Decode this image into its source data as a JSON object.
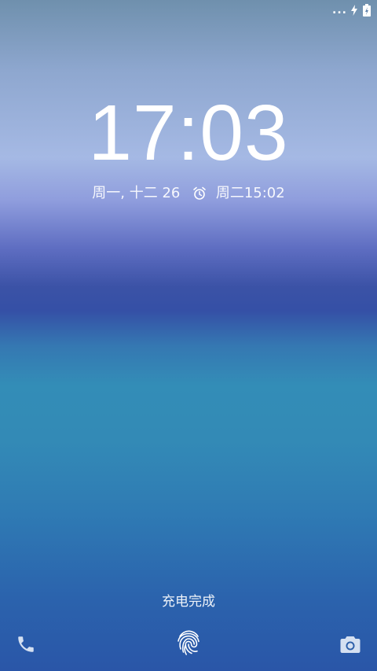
{
  "status_bar": {
    "icons": [
      "more-dots-icon",
      "charging-bolt-icon",
      "battery-icon"
    ],
    "dots": "..."
  },
  "lockscreen": {
    "time": "17:03",
    "date": "周一, 十二 26",
    "alarm_icon": "alarm-clock-icon",
    "next_alarm": "周二15:02",
    "charge_status": "充电完成"
  },
  "bottom_actions": {
    "left": "phone-icon",
    "center": "fingerprint-icon",
    "right": "camera-icon"
  }
}
